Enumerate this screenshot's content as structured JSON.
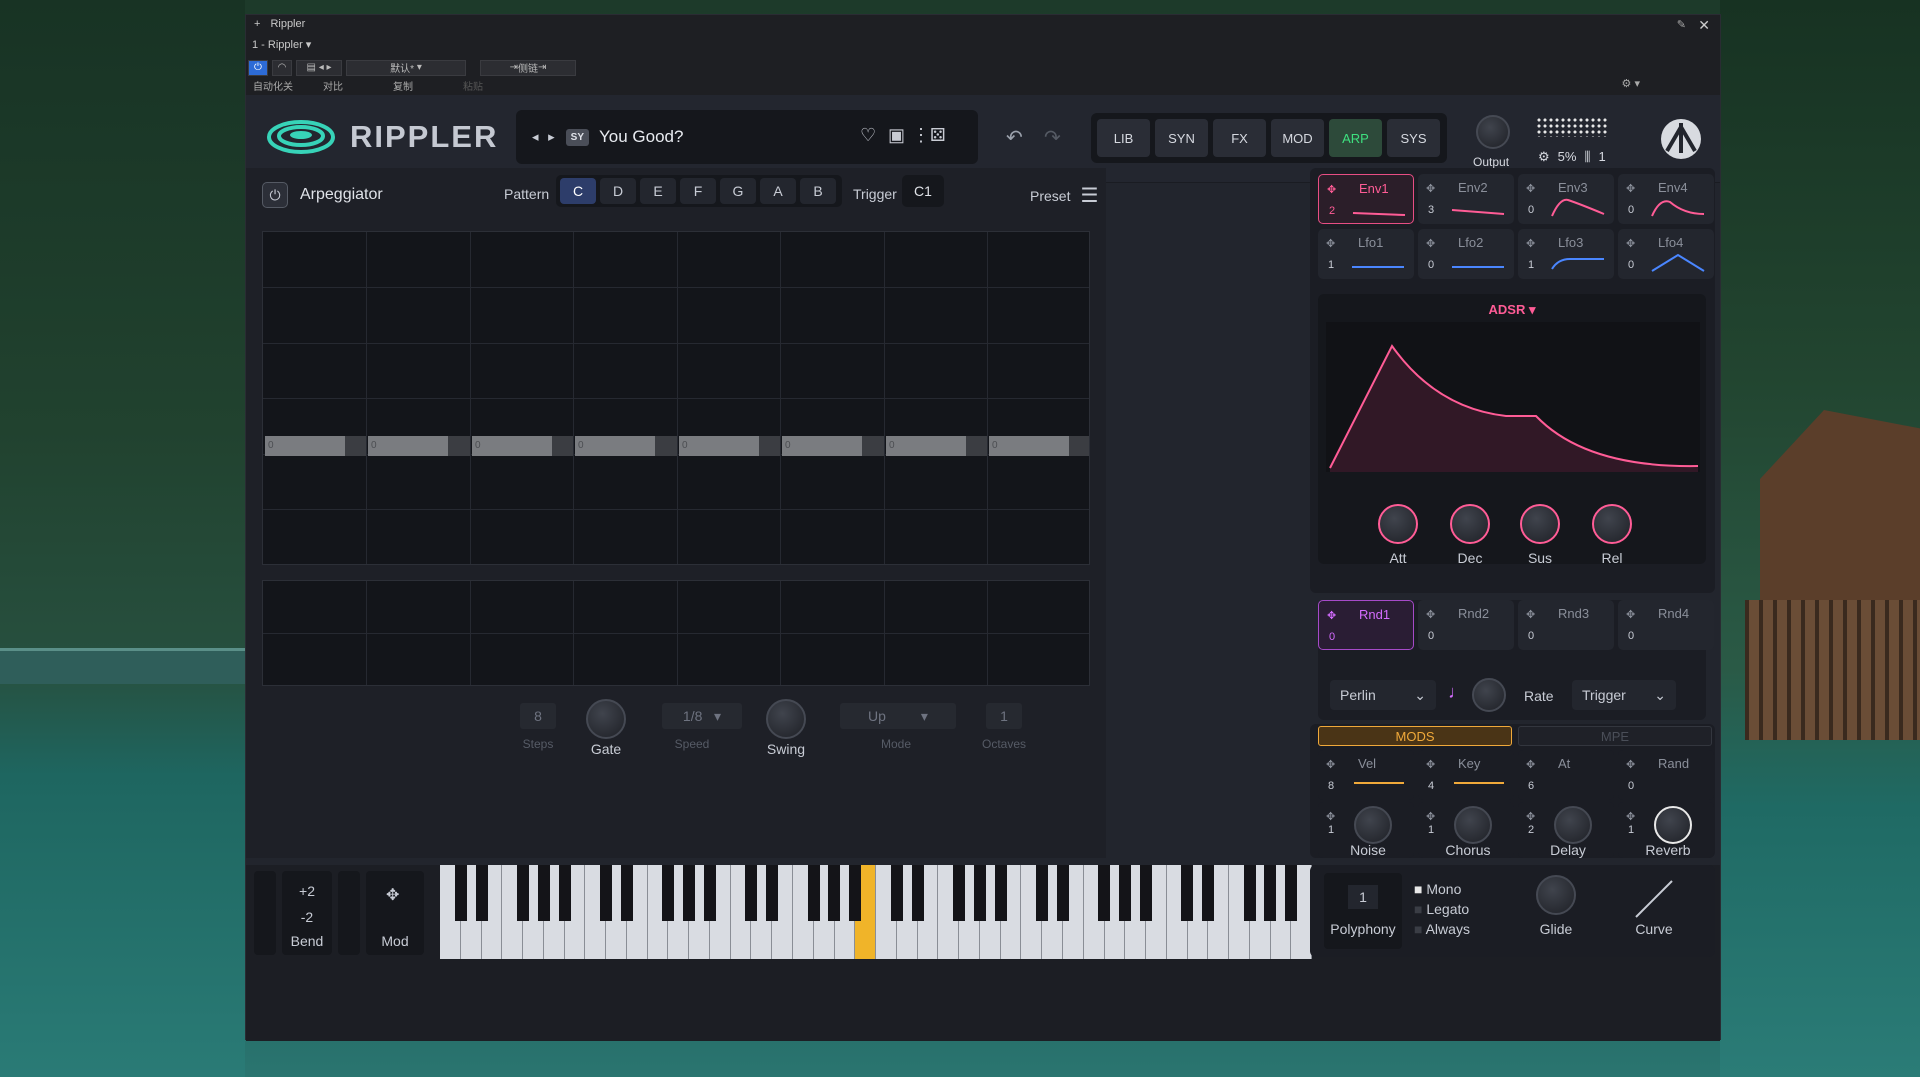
{
  "host": {
    "title": "Rippler",
    "instance": "1 - Rippler",
    "preset_default": "默认*",
    "side_chain": "侧链",
    "auto_off": "自动化关",
    "compare": "对比",
    "copy": "复制",
    "paste": "粘贴"
  },
  "header": {
    "logo": "RIPPLER",
    "preset_badge": "SY",
    "preset_name": "You Good?",
    "tabs": [
      "LIB",
      "SYN",
      "FX",
      "MOD",
      "ARP",
      "SYS"
    ],
    "active_tab": "ARP",
    "output_label": "Output",
    "cpu": "5%",
    "voices": "1"
  },
  "arp": {
    "title": "Arpeggiator",
    "pattern_label": "Pattern",
    "notes": [
      "C",
      "D",
      "E",
      "F",
      "G",
      "A",
      "B"
    ],
    "active_note": "C",
    "trigger_label": "Trigger",
    "trigger_value": "C1",
    "preset_label": "Preset",
    "steps_zero": [
      "0",
      "0",
      "0",
      "0",
      "0",
      "0",
      "0",
      "0"
    ],
    "steps_value": "8",
    "steps_label": "Steps",
    "gate_label": "Gate",
    "speed_value": "1/8",
    "speed_label": "Speed",
    "swing_label": "Swing",
    "mode_value": "Up",
    "mode_label": "Mode",
    "octaves_value": "1",
    "octaves_label": "Octaves"
  },
  "envs": [
    {
      "name": "Env1",
      "count": "2"
    },
    {
      "name": "Env2",
      "count": "3"
    },
    {
      "name": "Env3",
      "count": "0"
    },
    {
      "name": "Env4",
      "count": "0"
    }
  ],
  "lfos": [
    {
      "name": "Lfo1",
      "count": "1"
    },
    {
      "name": "Lfo2",
      "count": "0"
    },
    {
      "name": "Lfo3",
      "count": "1"
    },
    {
      "name": "Lfo4",
      "count": "0"
    }
  ],
  "adsr": {
    "label": "ADSR",
    "knobs": [
      "Att",
      "Dec",
      "Sus",
      "Rel"
    ]
  },
  "rnds": [
    {
      "name": "Rnd1",
      "count": "0"
    },
    {
      "name": "Rnd2",
      "count": "0"
    },
    {
      "name": "Rnd3",
      "count": "0"
    },
    {
      "name": "Rnd4",
      "count": "0"
    }
  ],
  "rnd_ctrl": {
    "type": "Perlin",
    "rate_label": "Rate",
    "trigger": "Trigger"
  },
  "mods": {
    "tab_mods": "MODS",
    "tab_mpe": "MPE",
    "sources": [
      {
        "name": "Vel",
        "count": "8"
      },
      {
        "name": "Key",
        "count": "4"
      },
      {
        "name": "At",
        "count": "6"
      },
      {
        "name": "Rand",
        "count": "0"
      }
    ],
    "fx": [
      {
        "name": "Noise",
        "count": "1"
      },
      {
        "name": "Chorus",
        "count": "1"
      },
      {
        "name": "Delay",
        "count": "2"
      },
      {
        "name": "Reverb",
        "count": "1"
      }
    ]
  },
  "keys": {
    "bend_up": "+2",
    "bend_down": "-2",
    "bend_label": "Bend",
    "mod_label": "Mod"
  },
  "voice": {
    "polyphony_value": "1",
    "polyphony_label": "Polyphony",
    "mono": "Mono",
    "legato": "Legato",
    "always": "Always",
    "glide": "Glide",
    "curve": "Curve"
  },
  "colors": {
    "accent_green": "#3ee07f",
    "accent_pink": "#ff5c96",
    "accent_gold": "#f0a93a",
    "accent_blue": "#4a86ff"
  }
}
